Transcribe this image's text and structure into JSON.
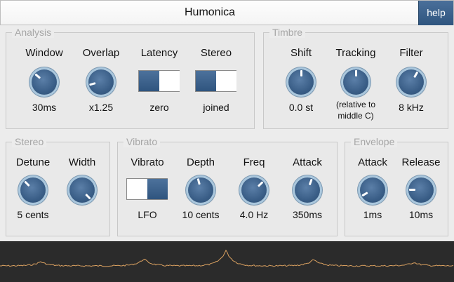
{
  "app": {
    "title": "Humonica",
    "help_label": "help"
  },
  "colors": {
    "accent": "#3a5e87",
    "knob_ring": "#aac7dd",
    "waveform": "#d9a060",
    "waveform_bg": "#2b2b2b",
    "group_title": "#a6a6a6"
  },
  "groups": {
    "analysis": {
      "title": "Analysis",
      "controls": [
        {
          "label": "Window",
          "value": "30ms",
          "type": "knob",
          "knob_deg": -50
        },
        {
          "label": "Overlap",
          "value": "x1.25",
          "type": "knob",
          "knob_deg": -105
        },
        {
          "label": "Latency",
          "value": "zero",
          "type": "toggle",
          "state": "left"
        },
        {
          "label": "Stereo",
          "value": "joined",
          "type": "toggle",
          "state": "left"
        }
      ]
    },
    "timbre": {
      "title": "Timbre",
      "controls": [
        {
          "label": "Shift",
          "value": "0.0 st",
          "type": "knob",
          "knob_deg": 0
        },
        {
          "label": "Tracking",
          "value_lines": [
            "(relative to",
            "middle C)"
          ],
          "type": "knob",
          "knob_deg": 0
        },
        {
          "label": "Filter",
          "value": "8 kHz",
          "type": "knob",
          "knob_deg": 30
        }
      ]
    },
    "stereo": {
      "title": "Stereo",
      "controls": [
        {
          "label": "Detune",
          "value": "5 cents",
          "type": "knob",
          "knob_deg": -45
        },
        {
          "label": "Width",
          "type": "knob",
          "knob_deg": 135
        }
      ]
    },
    "vibrato": {
      "title": "Vibrato",
      "controls": [
        {
          "label": "Vibrato",
          "value": "LFO",
          "type": "toggle",
          "state": "right"
        },
        {
          "label": "Depth",
          "value": "10 cents",
          "type": "knob",
          "knob_deg": -15
        },
        {
          "label": "Freq",
          "value": "4.0 Hz",
          "type": "knob",
          "knob_deg": 45
        },
        {
          "label": "Attack",
          "value": "350ms",
          "type": "knob",
          "knob_deg": 20
        }
      ]
    },
    "envelope": {
      "title": "Envelope",
      "controls": [
        {
          "label": "Attack",
          "value": "1ms",
          "type": "knob",
          "knob_deg": -120
        },
        {
          "label": "Release",
          "value": "10ms",
          "type": "knob",
          "knob_deg": -90
        }
      ]
    }
  },
  "waveform": {
    "label": "spectrum-display"
  }
}
